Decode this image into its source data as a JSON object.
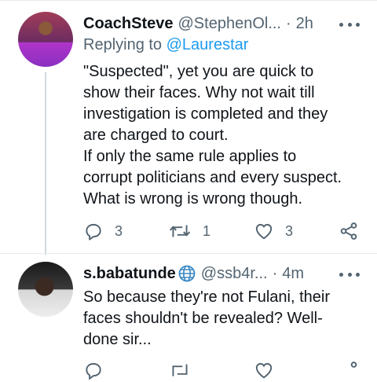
{
  "tweets": [
    {
      "name": "CoachSteve",
      "handle": "@StephenOl...",
      "time": "2h",
      "reply_prefix": "Replying to ",
      "reply_to": "@Laurestar",
      "text": "\"Suspected\", yet you are quick to\nshow their faces. Why not wait till\ninvestigation is completed and they\nare charged to court.\nIf only the same rule applies to\ncorrupt politicians and every suspect.\nWhat is wrong is wrong though.",
      "replies": "3",
      "retweets": "1",
      "likes": "3",
      "icons": {
        "reply": "reply-icon",
        "retweet": "retweet-icon",
        "like": "heart-icon",
        "share": "share-icon"
      }
    },
    {
      "name": "s.babatunde",
      "handle": "@ssb4r...",
      "time": "4m",
      "badge_icon": "globe-icon",
      "text": "So because they're not Fulani, their\nfaces shouldn't be revealed? Well-\ndone sir..."
    }
  ],
  "colors": {
    "accent": "#1d9bf0",
    "secondary_text": "#536471",
    "primary_text": "#0f1419"
  }
}
